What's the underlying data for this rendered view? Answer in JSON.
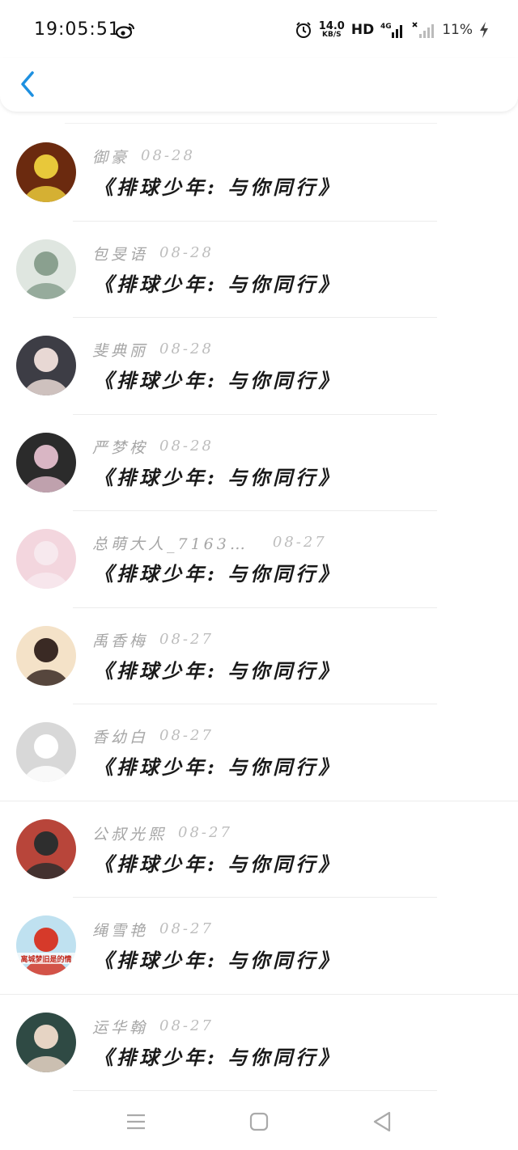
{
  "status_bar": {
    "time": "19:05:51",
    "net_speed_value": "14.0",
    "net_speed_unit": "KB/S",
    "hd_label": "HD",
    "network_type": "4G",
    "battery": "11%"
  },
  "header": {
    "back_icon": "chevron-left-icon",
    "accent_color": "#1e90e0"
  },
  "items": [
    {
      "name": "御豪",
      "date": "08-28",
      "title": "《排球少年: 与你同行》",
      "avatar_colors": [
        "#6b2a0f",
        "#e8c83a"
      ]
    },
    {
      "name": "包旻语",
      "date": "08-28",
      "title": "《排球少年: 与你同行》",
      "avatar_colors": [
        "#dfe6e0",
        "#8aa08f"
      ]
    },
    {
      "name": "斐典丽",
      "date": "08-28",
      "title": "《排球少年: 与你同行》",
      "avatar_colors": [
        "#3d3d45",
        "#e8d8d4"
      ]
    },
    {
      "name": "严梦桉",
      "date": "08-28",
      "title": "《排球少年: 与你同行》",
      "avatar_colors": [
        "#2b2b2b",
        "#d9b6c4"
      ]
    },
    {
      "name": "总萌大人_7163…",
      "date": "08-27",
      "title": "《排球少年: 与你同行》",
      "avatar_colors": [
        "#f3d6de",
        "#f7e9ee"
      ]
    },
    {
      "name": "禹香梅",
      "date": "08-27",
      "title": "《排球少年: 与你同行》",
      "avatar_colors": [
        "#f4e2c8",
        "#3a2a24"
      ]
    },
    {
      "name": "香幼白",
      "date": "08-27",
      "title": "《排球少年: 与你同行》",
      "avatar_colors": [
        "#d8d8d8",
        "#ffffff"
      ]
    },
    {
      "name": "公叔光熙",
      "date": "08-27",
      "title": "《排球少年: 与你同行》",
      "avatar_colors": [
        "#b8453a",
        "#2e2e2e"
      ]
    },
    {
      "name": "绳雪艳",
      "date": "08-27",
      "title": "《排球少年: 与你同行》",
      "avatar_colors": [
        "#bfe1f0",
        "#d63a2a"
      ],
      "avatar_caption": "离城梦旧是的情"
    },
    {
      "name": "运华翰",
      "date": "08-27",
      "title": "《排球少年: 与你同行》",
      "avatar_colors": [
        "#2f4a44",
        "#e6d4c4"
      ]
    }
  ],
  "navbar": {
    "menu_icon": "menu-icon",
    "home_icon": "home-square-icon",
    "back_icon": "back-triangle-icon"
  }
}
